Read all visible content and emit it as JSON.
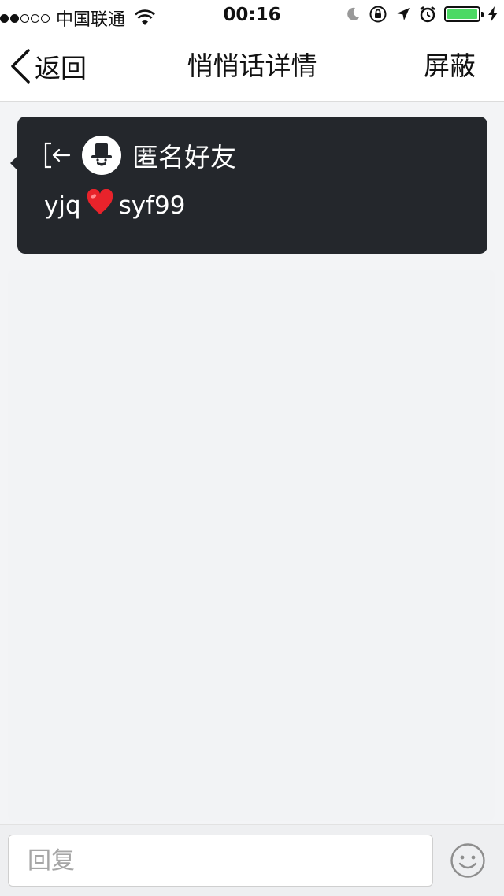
{
  "status_bar": {
    "carrier": "中国联通",
    "time": "00:16",
    "signal_bars_filled": 2,
    "signal_bars_total": 5
  },
  "nav": {
    "back_label": "返回",
    "title": "悄悄话详情",
    "right_label": "屏蔽"
  },
  "message": {
    "sender": "匿名好友",
    "text_before": "yjq",
    "emoji": "❤️",
    "text_after": "syf99"
  },
  "input": {
    "placeholder": "回复",
    "value": ""
  },
  "colors": {
    "card_bg": "#24272c",
    "battery": "#4cd964",
    "page_bg": "#f3f4f6"
  },
  "icons": {
    "back": "chevron-left-icon",
    "exit": "exit-icon",
    "avatar": "anonymous-hat-icon",
    "emoji": "smiley-icon"
  }
}
